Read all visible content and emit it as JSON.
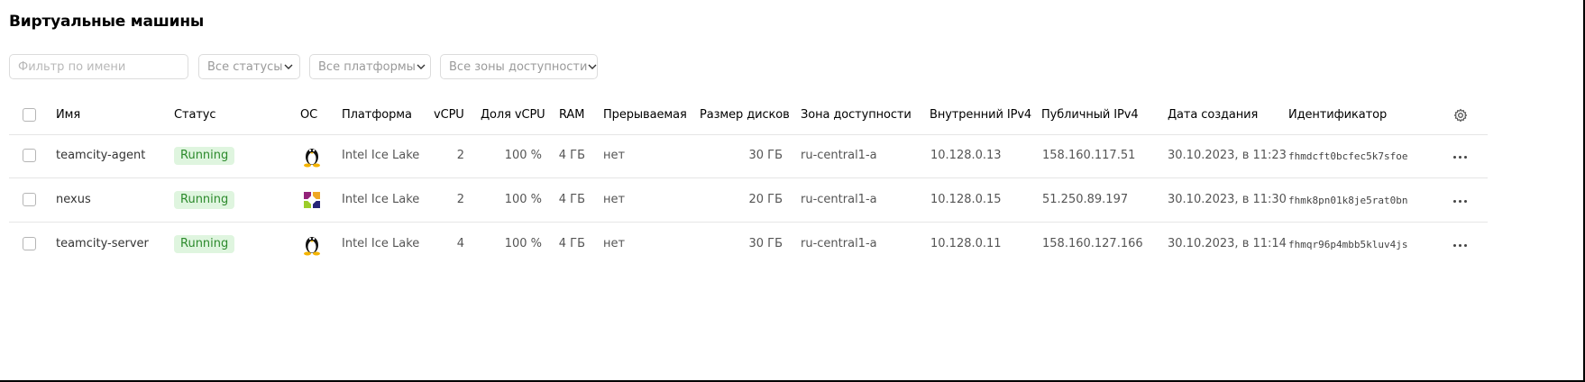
{
  "page": {
    "title": "Виртуальные машины"
  },
  "filters": {
    "name_placeholder": "Фильтр по имени",
    "status_select": "Все статусы",
    "platform_select": "Все платформы",
    "zone_select": "Все зоны доступности"
  },
  "table": {
    "headers": {
      "name": "Имя",
      "status": "Статус",
      "os": "ОС",
      "platform": "Платформа",
      "vcpu": "vCPU",
      "vcpu_share": "Доля vCPU",
      "ram": "RAM",
      "preemptible": "Прерываемая",
      "disk_size": "Размер дисков",
      "zone": "Зона доступности",
      "internal_ip": "Внутренний IPv4",
      "public_ip": "Публичный IPv4",
      "created": "Дата создания",
      "id": "Идентификатор"
    },
    "rows": [
      {
        "name": "teamcity-agent",
        "status": "Running",
        "os_icon": "linux-tux-icon",
        "platform": "Intel Ice Lake",
        "vcpu": "2",
        "vcpu_share": "100 %",
        "ram": "4 ГБ",
        "preemptible": "нет",
        "disk_size": "30 ГБ",
        "zone": "ru-central1-a",
        "internal_ip": "10.128.0.13",
        "public_ip": "158.160.117.51",
        "created": "30.10.2023, в 11:23",
        "id": "fhmdcft0bcfec5k7sfoe"
      },
      {
        "name": "nexus",
        "status": "Running",
        "os_icon": "centos-icon",
        "platform": "Intel Ice Lake",
        "vcpu": "2",
        "vcpu_share": "100 %",
        "ram": "4 ГБ",
        "preemptible": "нет",
        "disk_size": "20 ГБ",
        "zone": "ru-central1-a",
        "internal_ip": "10.128.0.15",
        "public_ip": "51.250.89.197",
        "created": "30.10.2023, в 11:30",
        "id": "fhmk8pn01k8je5rat0bn"
      },
      {
        "name": "teamcity-server",
        "status": "Running",
        "os_icon": "linux-tux-icon",
        "platform": "Intel Ice Lake",
        "vcpu": "4",
        "vcpu_share": "100 %",
        "ram": "4 ГБ",
        "preemptible": "нет",
        "disk_size": "30 ГБ",
        "zone": "ru-central1-a",
        "internal_ip": "10.128.0.11",
        "public_ip": "158.160.127.166",
        "created": "30.10.2023, в 11:14",
        "id": "fhmqr96p4mbb5kluv4js"
      }
    ]
  },
  "colors": {
    "running_bg": "#dff5df",
    "running_text": "#2c8a2c",
    "border": "#dcdcdc",
    "row_divider": "#e6e6e6"
  }
}
